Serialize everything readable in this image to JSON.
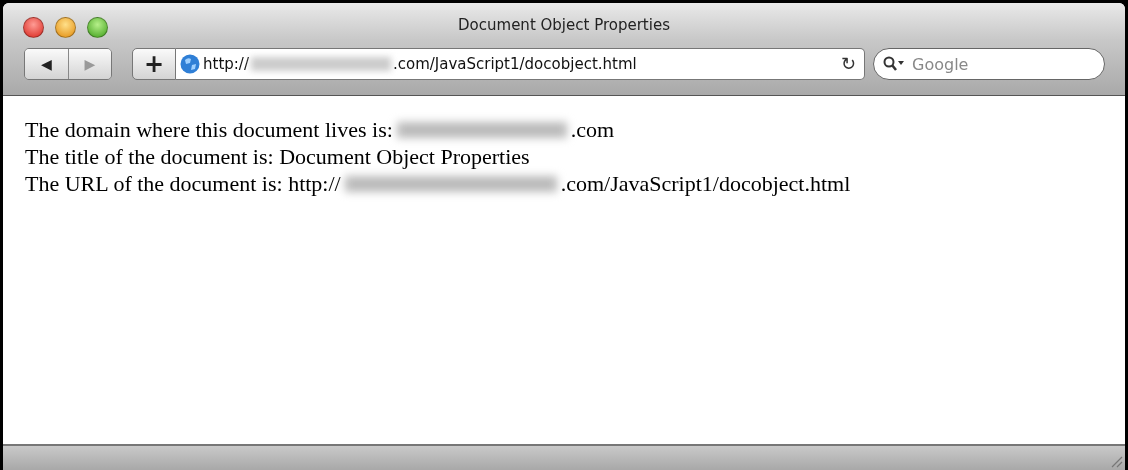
{
  "window": {
    "title": "Document Object Properties"
  },
  "toolbar": {
    "back_button": "◀",
    "forward_button": "▶",
    "forward_disabled": true,
    "add_button": "+",
    "address": {
      "parts": [
        {
          "kind": "text",
          "text": "http://"
        },
        {
          "kind": "redacted"
        },
        {
          "kind": "text",
          "text": ".com/JavaScript1/docobject.html"
        }
      ]
    },
    "reload_button": "↻",
    "search": {
      "placeholder": "Google"
    }
  },
  "content": {
    "lines": [
      {
        "parts": [
          {
            "kind": "text",
            "text": "The domain where this document lives is:"
          },
          {
            "kind": "redacted"
          },
          {
            "kind": "text",
            "text": ".com"
          }
        ]
      },
      {
        "parts": [
          {
            "kind": "text",
            "text": "The title of the document is: Document Object Properties"
          }
        ]
      },
      {
        "parts": [
          {
            "kind": "text",
            "text": "The URL of the document is: http://"
          },
          {
            "kind": "redacted"
          },
          {
            "kind": "text",
            "text": ".com/JavaScript1/docobject.html"
          }
        ]
      }
    ]
  }
}
